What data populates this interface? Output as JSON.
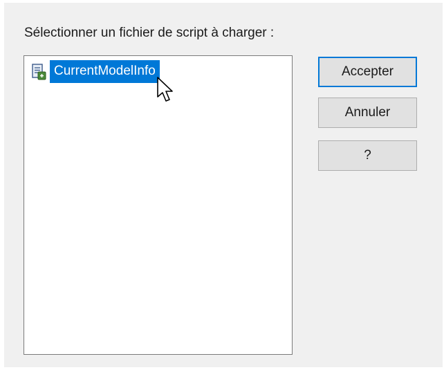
{
  "dialog": {
    "prompt": "Sélectionner un fichier de script à charger :",
    "list": {
      "items": [
        {
          "label": "CurrentModelInfo",
          "icon": "script-file-icon",
          "selected": true
        }
      ]
    },
    "buttons": {
      "accept": "Accepter",
      "cancel": "Annuler",
      "help": "?"
    },
    "colors": {
      "selection": "#0078d7",
      "background": "#f0f0f0"
    }
  }
}
